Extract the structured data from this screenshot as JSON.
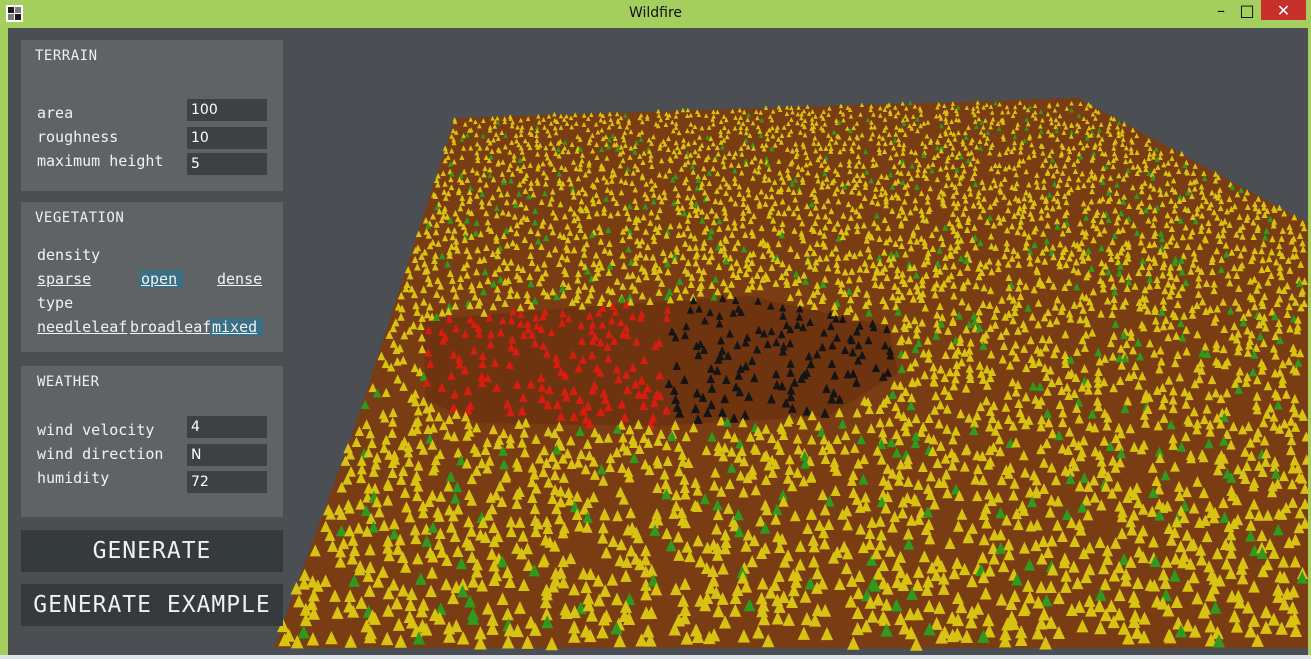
{
  "window": {
    "title": "Wildfire",
    "icon": "app-icon",
    "controls": {
      "minimize": "–",
      "maximize": "□",
      "close": "✕"
    }
  },
  "terrain": {
    "heading": "TERRAIN",
    "fields": [
      {
        "label": "area",
        "value": "100"
      },
      {
        "label": "roughness",
        "value": "10"
      },
      {
        "label": "maximum height",
        "value": "5"
      }
    ]
  },
  "vegetation": {
    "heading": "VEGETATION",
    "density_label": "density",
    "density_options": [
      "sparse",
      "open",
      "dense"
    ],
    "density_selected": "open",
    "type_label": "type",
    "type_options": [
      "needleleaf",
      "broadleaf",
      "mixed"
    ],
    "type_selected": "mixed"
  },
  "weather": {
    "heading": "WEATHER",
    "fields": [
      {
        "label": "wind velocity",
        "value": "4"
      },
      {
        "label": "wind direction",
        "value": "N"
      },
      {
        "label": "humidity",
        "value": "72"
      }
    ]
  },
  "buttons": {
    "generate": "GENERATE",
    "generate_example": "GENERATE EXAMPLE"
  },
  "colors": {
    "title_bar": "#a4cf5f",
    "viewport_bg": "#4b4e52",
    "panel_bg": "#5f6366",
    "field_bg": "#3e4144",
    "selected_option": "#3b6f86",
    "ground": "#7a3c12",
    "tree_healthy": "#d9c312",
    "tree_green": "#2f9a1e",
    "tree_burning": "#d81c10",
    "tree_burnt": "#141414"
  }
}
